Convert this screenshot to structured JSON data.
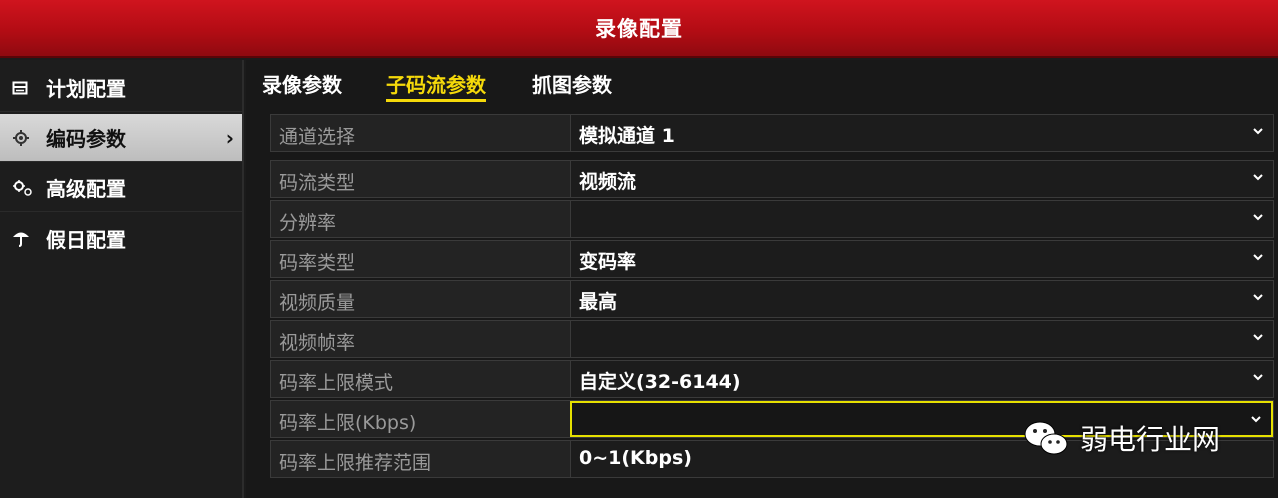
{
  "window": {
    "title": "录像配置"
  },
  "sidebar": {
    "items": [
      {
        "label": "计划配置",
        "icon": "calendar-icon"
      },
      {
        "label": "编码参数",
        "icon": "gear-icon",
        "active": true
      },
      {
        "label": "高级配置",
        "icon": "advanced-gears-icon"
      },
      {
        "label": "假日配置",
        "icon": "umbrella-icon"
      }
    ]
  },
  "tabs": [
    {
      "label": "录像参数"
    },
    {
      "label": "子码流参数",
      "active": true
    },
    {
      "label": "抓图参数"
    }
  ],
  "form": {
    "rows": [
      {
        "label": "通道选择",
        "value": "模拟通道 1"
      },
      {
        "label": "码流类型",
        "value": "视频流"
      },
      {
        "label": "分辨率",
        "value": ""
      },
      {
        "label": "码率类型",
        "value": "变码率"
      },
      {
        "label": "视频质量",
        "value": "最高"
      },
      {
        "label": "视频帧率",
        "value": ""
      },
      {
        "label": "码率上限模式",
        "value": "自定义(32-6144)"
      },
      {
        "label": "码率上限(Kbps)",
        "value": ""
      },
      {
        "label": "码率上限推荐范围",
        "value": "0~1(Kbps)"
      }
    ]
  },
  "watermark": {
    "text": "弱电行业网",
    "icon": "wechat-icon"
  },
  "colors": {
    "title_bar": "#c0101a",
    "tab_active": "#f5d90a",
    "highlight_border": "#e6e000"
  }
}
